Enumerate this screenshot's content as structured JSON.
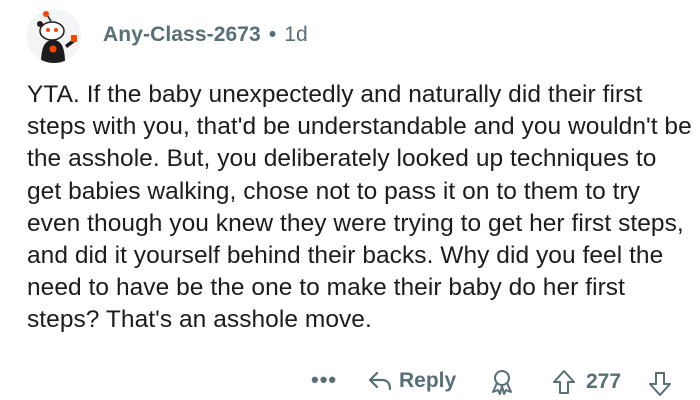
{
  "comment": {
    "author": "Any-Class-2673",
    "separator": "•",
    "age": "1d",
    "body": "YTA. If the baby unexpectedly and naturally did their first steps with you, that'd be understandable and you wouldn't be the asshole. But, you deliberately looked up techniques to get babies walking, chose not to pass it on to them to try even though you knew they were trying to get her first steps, and did it yourself behind their backs. Why did you feel the need to have be the one to make their baby do her first steps? That's an asshole move."
  },
  "actions": {
    "more_label": "•••",
    "reply_label": "Reply",
    "score": "277"
  },
  "icons": {
    "avatar": "reddit-snoo-avatar-icon",
    "reply": "reply-arrow-icon",
    "award": "award-icon",
    "upvote": "upvote-arrow-icon",
    "downvote": "downvote-arrow-icon"
  },
  "colors": {
    "meta_text": "#576f76",
    "body_text": "#1c1c1c",
    "background": "#ffffff",
    "avatar_bg": "#f2f4f5"
  }
}
